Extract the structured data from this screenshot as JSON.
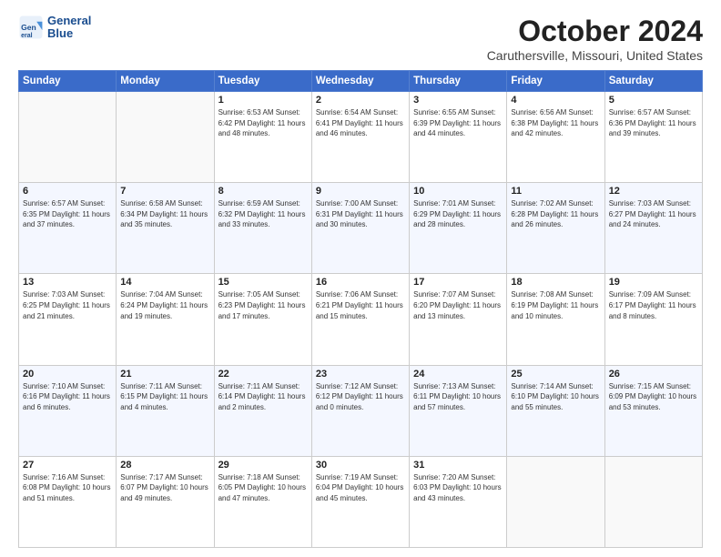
{
  "header": {
    "logo_line1": "General",
    "logo_line2": "Blue",
    "title": "October 2024",
    "subtitle": "Caruthersville, Missouri, United States"
  },
  "days_of_week": [
    "Sunday",
    "Monday",
    "Tuesday",
    "Wednesday",
    "Thursday",
    "Friday",
    "Saturday"
  ],
  "weeks": [
    [
      {
        "day": "",
        "info": ""
      },
      {
        "day": "",
        "info": ""
      },
      {
        "day": "1",
        "info": "Sunrise: 6:53 AM\nSunset: 6:42 PM\nDaylight: 11 hours and 48 minutes."
      },
      {
        "day": "2",
        "info": "Sunrise: 6:54 AM\nSunset: 6:41 PM\nDaylight: 11 hours and 46 minutes."
      },
      {
        "day": "3",
        "info": "Sunrise: 6:55 AM\nSunset: 6:39 PM\nDaylight: 11 hours and 44 minutes."
      },
      {
        "day": "4",
        "info": "Sunrise: 6:56 AM\nSunset: 6:38 PM\nDaylight: 11 hours and 42 minutes."
      },
      {
        "day": "5",
        "info": "Sunrise: 6:57 AM\nSunset: 6:36 PM\nDaylight: 11 hours and 39 minutes."
      }
    ],
    [
      {
        "day": "6",
        "info": "Sunrise: 6:57 AM\nSunset: 6:35 PM\nDaylight: 11 hours and 37 minutes."
      },
      {
        "day": "7",
        "info": "Sunrise: 6:58 AM\nSunset: 6:34 PM\nDaylight: 11 hours and 35 minutes."
      },
      {
        "day": "8",
        "info": "Sunrise: 6:59 AM\nSunset: 6:32 PM\nDaylight: 11 hours and 33 minutes."
      },
      {
        "day": "9",
        "info": "Sunrise: 7:00 AM\nSunset: 6:31 PM\nDaylight: 11 hours and 30 minutes."
      },
      {
        "day": "10",
        "info": "Sunrise: 7:01 AM\nSunset: 6:29 PM\nDaylight: 11 hours and 28 minutes."
      },
      {
        "day": "11",
        "info": "Sunrise: 7:02 AM\nSunset: 6:28 PM\nDaylight: 11 hours and 26 minutes."
      },
      {
        "day": "12",
        "info": "Sunrise: 7:03 AM\nSunset: 6:27 PM\nDaylight: 11 hours and 24 minutes."
      }
    ],
    [
      {
        "day": "13",
        "info": "Sunrise: 7:03 AM\nSunset: 6:25 PM\nDaylight: 11 hours and 21 minutes."
      },
      {
        "day": "14",
        "info": "Sunrise: 7:04 AM\nSunset: 6:24 PM\nDaylight: 11 hours and 19 minutes."
      },
      {
        "day": "15",
        "info": "Sunrise: 7:05 AM\nSunset: 6:23 PM\nDaylight: 11 hours and 17 minutes."
      },
      {
        "day": "16",
        "info": "Sunrise: 7:06 AM\nSunset: 6:21 PM\nDaylight: 11 hours and 15 minutes."
      },
      {
        "day": "17",
        "info": "Sunrise: 7:07 AM\nSunset: 6:20 PM\nDaylight: 11 hours and 13 minutes."
      },
      {
        "day": "18",
        "info": "Sunrise: 7:08 AM\nSunset: 6:19 PM\nDaylight: 11 hours and 10 minutes."
      },
      {
        "day": "19",
        "info": "Sunrise: 7:09 AM\nSunset: 6:17 PM\nDaylight: 11 hours and 8 minutes."
      }
    ],
    [
      {
        "day": "20",
        "info": "Sunrise: 7:10 AM\nSunset: 6:16 PM\nDaylight: 11 hours and 6 minutes."
      },
      {
        "day": "21",
        "info": "Sunrise: 7:11 AM\nSunset: 6:15 PM\nDaylight: 11 hours and 4 minutes."
      },
      {
        "day": "22",
        "info": "Sunrise: 7:11 AM\nSunset: 6:14 PM\nDaylight: 11 hours and 2 minutes."
      },
      {
        "day": "23",
        "info": "Sunrise: 7:12 AM\nSunset: 6:12 PM\nDaylight: 11 hours and 0 minutes."
      },
      {
        "day": "24",
        "info": "Sunrise: 7:13 AM\nSunset: 6:11 PM\nDaylight: 10 hours and 57 minutes."
      },
      {
        "day": "25",
        "info": "Sunrise: 7:14 AM\nSunset: 6:10 PM\nDaylight: 10 hours and 55 minutes."
      },
      {
        "day": "26",
        "info": "Sunrise: 7:15 AM\nSunset: 6:09 PM\nDaylight: 10 hours and 53 minutes."
      }
    ],
    [
      {
        "day": "27",
        "info": "Sunrise: 7:16 AM\nSunset: 6:08 PM\nDaylight: 10 hours and 51 minutes."
      },
      {
        "day": "28",
        "info": "Sunrise: 7:17 AM\nSunset: 6:07 PM\nDaylight: 10 hours and 49 minutes."
      },
      {
        "day": "29",
        "info": "Sunrise: 7:18 AM\nSunset: 6:05 PM\nDaylight: 10 hours and 47 minutes."
      },
      {
        "day": "30",
        "info": "Sunrise: 7:19 AM\nSunset: 6:04 PM\nDaylight: 10 hours and 45 minutes."
      },
      {
        "day": "31",
        "info": "Sunrise: 7:20 AM\nSunset: 6:03 PM\nDaylight: 10 hours and 43 minutes."
      },
      {
        "day": "",
        "info": ""
      },
      {
        "day": "",
        "info": ""
      }
    ]
  ]
}
